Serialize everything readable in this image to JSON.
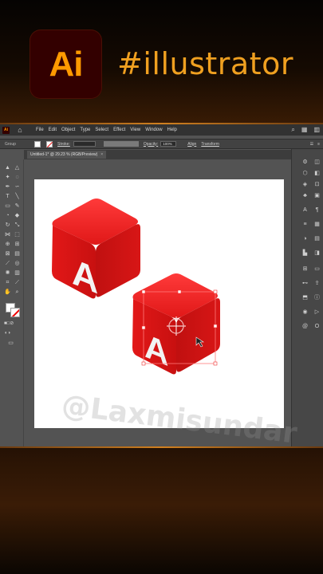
{
  "banner": {
    "logo_text": "Ai",
    "hashtag": "#illustrator",
    "brand_color": "#ff9a00",
    "logo_bg": "#330000"
  },
  "menubar": {
    "app_badge": "Ai",
    "items": [
      "File",
      "Edit",
      "Object",
      "Type",
      "Select",
      "Effect",
      "View",
      "Window",
      "Help"
    ]
  },
  "control_bar": {
    "selection_label": "Group",
    "stroke_label": "Stroke:",
    "opacity_label": "Opacity:",
    "opacity_value": "100%",
    "align_label": "Align",
    "transform_label": "Transform"
  },
  "document_tab": {
    "title": "Untitled-1* @ 29.23 % (RGB/Preview)",
    "close_glyph": "×"
  },
  "artwork": {
    "cube_letter": "A",
    "cube_color": "#e21b1b"
  },
  "watermark": "@Laxmisundar"
}
